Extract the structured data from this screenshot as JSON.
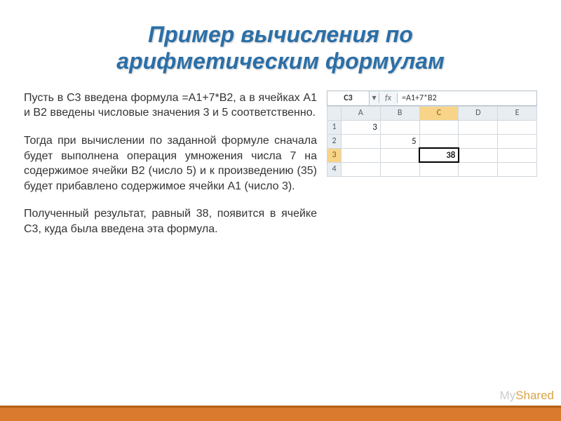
{
  "title_line1": "Пример вычисления по",
  "title_line2": "арифметическим формулам",
  "para1": "Пусть в C3 введена формула =A1+7*B2, а в ячейках A1 и B2 введены числовые значения 3 и 5 соответственно.",
  "para2": "Тогда при вычислении по заданной формуле сначала будет выполнена операция умножения числа 7 на содержимое ячейки B2 (число 5) и к произведению (35) будет прибавлено содержимое ячейки A1 (число 3).",
  "para3": "Полученный результат, равный 38, появится в ячейке C3, куда была введена эта формула.",
  "spreadsheet": {
    "name_box": "C3",
    "fx_label": "fx",
    "formula": "=A1+7*B2",
    "columns": [
      "A",
      "B",
      "C",
      "D",
      "E"
    ],
    "rows": [
      "1",
      "2",
      "3",
      "4"
    ],
    "active_col": "C",
    "active_row": "3",
    "cells": {
      "A1": "3",
      "B2": "5",
      "C3": "38"
    }
  },
  "watermark": {
    "pre": "My",
    "accent": "Shared"
  },
  "chart_data": {
    "type": "table",
    "title": "Spreadsheet example",
    "columns": [
      "A",
      "B",
      "C",
      "D",
      "E"
    ],
    "rows": [
      {
        "row": 1,
        "A": 3,
        "B": null,
        "C": null,
        "D": null,
        "E": null
      },
      {
        "row": 2,
        "A": null,
        "B": 5,
        "C": null,
        "D": null,
        "E": null
      },
      {
        "row": 3,
        "A": null,
        "B": null,
        "C": 38,
        "D": null,
        "E": null
      },
      {
        "row": 4,
        "A": null,
        "B": null,
        "C": null,
        "D": null,
        "E": null
      }
    ],
    "selected_cell": "C3",
    "formula_in_selected_cell": "=A1+7*B2"
  }
}
